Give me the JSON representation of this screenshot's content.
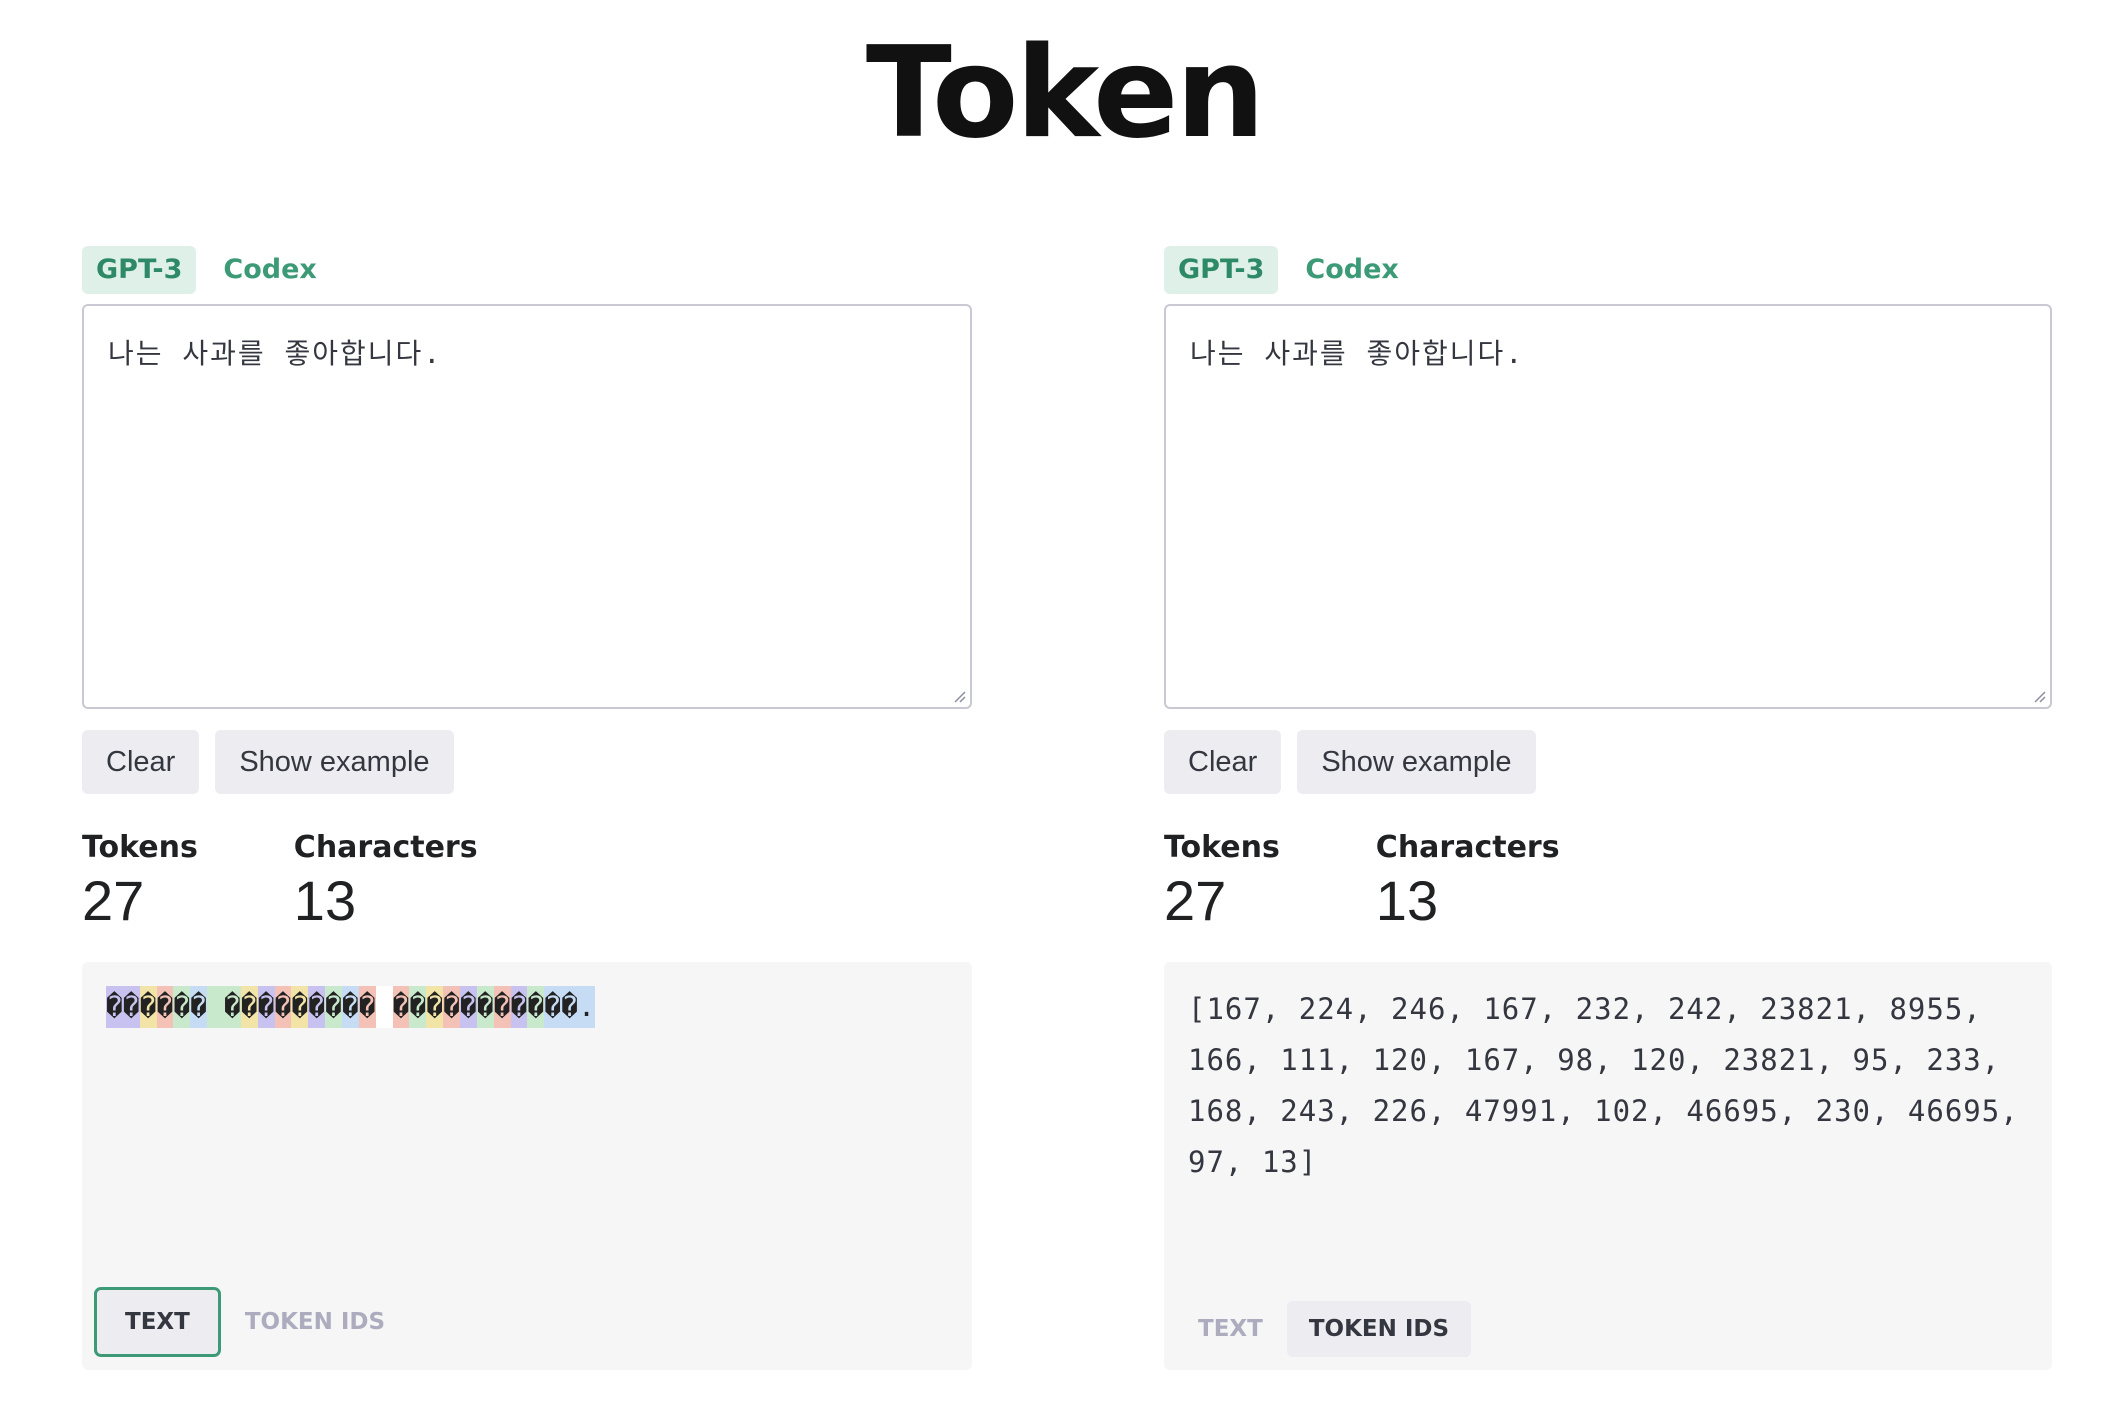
{
  "title": "Token",
  "panels": [
    {
      "model_tabs": [
        "GPT-3",
        "Codex"
      ],
      "active_model": "GPT-3",
      "input_text": "나는 사과를 좋아합니다.",
      "buttons": {
        "clear": "Clear",
        "show_example": "Show example"
      },
      "stats": {
        "tokens_label": "Tokens",
        "tokens_value": "27",
        "characters_label": "Characters",
        "characters_value": "13"
      },
      "output_mode": "text",
      "tokens": [
        {
          "text": "�",
          "color": "#c7c2ef"
        },
        {
          "text": "�",
          "color": "#c7c2ef"
        },
        {
          "text": "�",
          "color": "#f2e3a6"
        },
        {
          "text": "�",
          "color": "#f4c1b7"
        },
        {
          "text": "�",
          "color": "#c8e9cc"
        },
        {
          "text": "�",
          "color": "#c6dcf4"
        },
        {
          "text": " ",
          "color": "#c8e9cc"
        },
        {
          "text": "�",
          "color": "#c8e9cc"
        },
        {
          "text": "�",
          "color": "#f2e3a6"
        },
        {
          "text": "�",
          "color": "#c7c2ef"
        },
        {
          "text": "�",
          "color": "#f4c1b7"
        },
        {
          "text": "�",
          "color": "#f2e3a6"
        },
        {
          "text": "�",
          "color": "#c7c2ef"
        },
        {
          "text": "�",
          "color": "#c8e9cc"
        },
        {
          "text": "�",
          "color": "#c6dcf4"
        },
        {
          "text": "�",
          "color": "#f4c1b7"
        },
        {
          "text": " ",
          "color": "#ffffff"
        },
        {
          "text": "�",
          "color": "#f4c1b7"
        },
        {
          "text": "�",
          "color": "#c8e9cc"
        },
        {
          "text": "�",
          "color": "#f2e3a6"
        },
        {
          "text": "�",
          "color": "#f4c1b7"
        },
        {
          "text": "�",
          "color": "#c7c2ef"
        },
        {
          "text": "�",
          "color": "#c8e9cc"
        },
        {
          "text": "�",
          "color": "#f4c1b7"
        },
        {
          "text": "�",
          "color": "#c7c2ef"
        },
        {
          "text": "�",
          "color": "#c8e9cc"
        },
        {
          "text": "�",
          "color": "#c6dcf4"
        },
        {
          "text": "�",
          "color": "#c6dcf4"
        },
        {
          "text": ".",
          "color": "#c6dcf4"
        }
      ],
      "view_tabs": {
        "text": "TEXT",
        "token_ids": "TOKEN IDS"
      }
    },
    {
      "model_tabs": [
        "GPT-3",
        "Codex"
      ],
      "active_model": "GPT-3",
      "input_text": "나는 사과를 좋아합니다.",
      "buttons": {
        "clear": "Clear",
        "show_example": "Show example"
      },
      "stats": {
        "tokens_label": "Tokens",
        "tokens_value": "27",
        "characters_label": "Characters",
        "characters_value": "13"
      },
      "output_mode": "token_ids",
      "token_ids_text": "[167, 224, 246, 167, 232, 242, 23821, 8955, 166, 111, 120, 167, 98, 120, 23821, 95, 233, 168, 243, 226, 47991, 102, 46695, 230, 46695, 97, 13]",
      "view_tabs": {
        "text": "TEXT",
        "token_ids": "TOKEN IDS"
      }
    }
  ],
  "colors": {
    "accent_green": "#3d9a77",
    "active_tab_bg": "#dff0e8",
    "button_bg": "#ececf1",
    "output_bg": "#f6f6f7"
  }
}
